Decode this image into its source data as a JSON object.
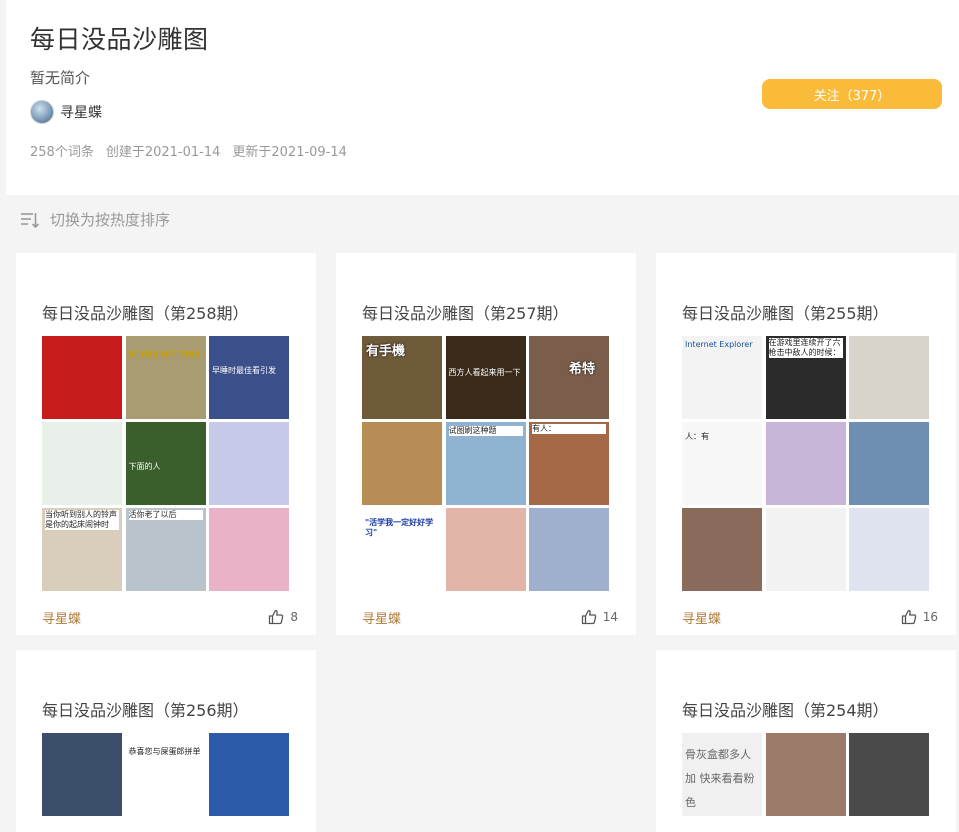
{
  "page": {
    "title": "每日没品沙雕图",
    "intro": "暂无简介",
    "author": "寻星蝶",
    "entry_count": "258个词条",
    "created": "创建于2021-01-14",
    "updated": "更新于2021-09-14",
    "follow_label": "关注（377）",
    "accent_color": "#fbbb3a"
  },
  "sort": {
    "label": "切换为按热度排序",
    "icon": "sort-icon"
  },
  "cards": [
    {
      "title": "每日没品沙雕图（第258期）",
      "author": "寻星蝶",
      "likes": "8",
      "thumbs": [
        {
          "bg": "#c81c1c",
          "text": ""
        },
        {
          "bg": "#a99b72",
          "text": "IF YOU HIT THIS"
        },
        {
          "bg": "#3b4f8a",
          "text": "早睡时最佳看引发"
        },
        {
          "bg": "#e9efe9",
          "text": ""
        },
        {
          "bg": "#3a5e2c",
          "text": "下面的人"
        },
        {
          "bg": "#c7c9e8",
          "text": ""
        },
        {
          "bg": "#d9cdbc",
          "text": "当你听到别人的铃声是你的起床闹钟时"
        },
        {
          "bg": "#b9c3cc",
          "text": "活你老了以后"
        },
        {
          "bg": "#e9b2c8",
          "text": ""
        }
      ]
    },
    {
      "title": "每日没品沙雕图（第257期）",
      "author": "寻星蝶",
      "likes": "14",
      "thumbs": [
        {
          "bg": "#6f5a3a",
          "text": "有手機"
        },
        {
          "bg": "#3a2a1a",
          "text": "西方人看起来用一下"
        },
        {
          "bg": "#7a5d4a",
          "text": "希特"
        },
        {
          "bg": "#b78c55",
          "text": ""
        },
        {
          "bg": "#8fb3d1",
          "text": "试图刷这种题"
        },
        {
          "bg": "#a56a45",
          "text": "有人："
        },
        {
          "bg": "#ffffff",
          "text": "\"活学我一定好好学习\""
        },
        {
          "bg": "#e3b4a8",
          "text": ""
        },
        {
          "bg": "#9fb0cf",
          "text": ""
        }
      ]
    },
    {
      "title": "每日没品沙雕图（第255期）",
      "author": "寻星蝶",
      "likes": "16",
      "thumbs": [
        {
          "bg": "#f3f3f3",
          "text": "Internet Explorer"
        },
        {
          "bg": "#2b2b2b",
          "text": "在游戏里连续开了六枪击中敌人的时候："
        },
        {
          "bg": "#d8d4cc",
          "text": ""
        },
        {
          "bg": "#f7f7f7",
          "text": "人：有"
        },
        {
          "bg": "#c7b6d8",
          "text": ""
        },
        {
          "bg": "#6e8fb2",
          "text": ""
        },
        {
          "bg": "#8a6a5a",
          "text": ""
        },
        {
          "bg": "#f2f2f2",
          "text": ""
        },
        {
          "bg": "#dfe3ef",
          "text": ""
        }
      ]
    },
    {
      "title": "每日没品沙雕图（第256期）",
      "author": "",
      "likes": "",
      "thumbs": [
        {
          "bg": "#3b4f6a",
          "text": ""
        },
        {
          "bg": "#ffffff",
          "text": "恭喜您与屎蛋郎拼单"
        },
        {
          "bg": "#2a5aa8",
          "text": ""
        }
      ]
    },
    {
      "title": "每日没品沙雕图（第254期）",
      "author": "",
      "likes": "",
      "thumbs": [
        {
          "bg": "#f0f0f0",
          "text": "骨灰盒都多人加 快来看看粉色"
        },
        {
          "bg": "#9b7a6a",
          "text": ""
        },
        {
          "bg": "#4a4a4a",
          "text": ""
        }
      ]
    }
  ]
}
